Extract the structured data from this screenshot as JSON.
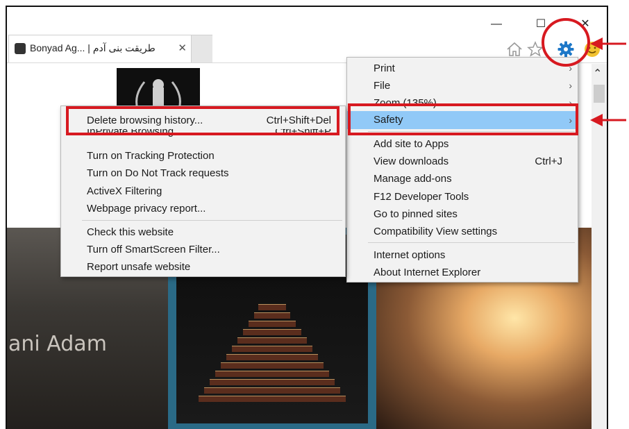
{
  "window": {
    "controls": {
      "minimize": "—",
      "maximize": "☐",
      "close": "✕"
    }
  },
  "tab": {
    "title": "Bonyad Ag... | طریقت بنی آدم",
    "close": "✕"
  },
  "toolbar": {
    "icons": [
      "home-icon",
      "star-icon",
      "gear-icon",
      "smiley-icon"
    ]
  },
  "page": {
    "left_strip_text": "ani Adam"
  },
  "tools_menu": {
    "items": [
      {
        "label": "Print",
        "shortcut": "",
        "arrow": "›"
      },
      {
        "label": "File",
        "shortcut": "",
        "arrow": "›"
      },
      {
        "label": "Zoom (135%)",
        "shortcut": "",
        "arrow": "›"
      },
      {
        "label": "Safety",
        "shortcut": "",
        "arrow": "›"
      },
      {
        "label": "Add site to Apps",
        "shortcut": "",
        "arrow": ""
      },
      {
        "label": "View downloads",
        "shortcut": "Ctrl+J",
        "arrow": ""
      },
      {
        "label": "Manage add-ons",
        "shortcut": "",
        "arrow": ""
      },
      {
        "label": "F12 Developer Tools",
        "shortcut": "",
        "arrow": ""
      },
      {
        "label": "Go to pinned sites",
        "shortcut": "",
        "arrow": ""
      },
      {
        "label": "Compatibility View settings",
        "shortcut": "",
        "arrow": ""
      },
      {
        "label": "Internet options",
        "shortcut": "",
        "arrow": ""
      },
      {
        "label": "About Internet Explorer",
        "shortcut": "",
        "arrow": ""
      }
    ]
  },
  "safety_menu": {
    "items": [
      {
        "label": "Delete browsing history...",
        "shortcut": "Ctrl+Shift+Del"
      },
      {
        "label": "InPrivate Browsing",
        "shortcut": "Ctrl+Shift+P"
      },
      {
        "label": "Turn on Tracking Protection",
        "shortcut": ""
      },
      {
        "label": "Turn on Do Not Track requests",
        "shortcut": ""
      },
      {
        "label": "ActiveX Filtering",
        "shortcut": ""
      },
      {
        "label": "Webpage privacy report...",
        "shortcut": ""
      },
      {
        "label": "Check this website",
        "shortcut": ""
      },
      {
        "label": "Turn off SmartScreen Filter...",
        "shortcut": ""
      },
      {
        "label": "Report unsafe website",
        "shortcut": ""
      }
    ]
  },
  "colors": {
    "annotation_red": "#d71920",
    "menu_highlight": "#91c9f7",
    "gear_blue": "#1e78c8"
  }
}
